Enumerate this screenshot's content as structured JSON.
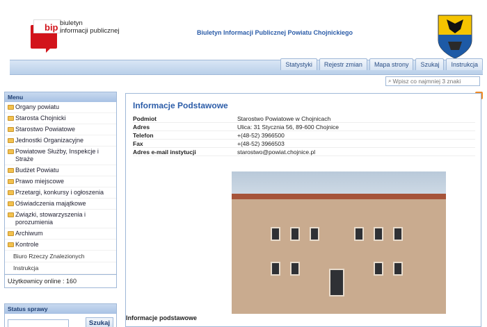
{
  "header": {
    "logo_bip": "bip",
    "logo_line1": "biuletyn",
    "logo_line2": "informacji publicznej",
    "site_title": "Biuletyn Informacji Publicznej Powiatu Chojnickiego"
  },
  "nav": {
    "tabs": [
      "Statystyki",
      "Rejestr zmian",
      "Mapa strony",
      "Szukaj",
      "Instrukcja"
    ],
    "search_placeholder": "Wpisz co najmniej 3 znaki"
  },
  "sidebar": {
    "menu_title": "Menu",
    "items": [
      "Organy powiatu",
      "Starosta Chojnicki",
      "Starostwo Powiatowe",
      "Jednostki Organizacyjne",
      "Powiatowe Służby, Inspekcje i Straże",
      "Budżet Powiatu",
      "Prawo miejscowe",
      "Przetargi, konkursy i ogłoszenia",
      "Oświadczenia majątkowe",
      "Związki, stowarzyszenia i porozumienia",
      "Archiwum",
      "Kontrole"
    ],
    "sub_items": [
      "Biuro Rzeczy Znalezionych",
      "Instrukcja"
    ],
    "online_label": "Użytkownicy online : 160",
    "status_title": "Status sprawy",
    "status_button": "Szukaj"
  },
  "main": {
    "title": "Informacje Podstawowe",
    "rows": [
      {
        "label": "Podmiot",
        "value": "Starostwo Powiatowe w Chojnicach"
      },
      {
        "label": "Adres",
        "value": "Ulica: 31 Stycznia 56, 89-600 Chojnice"
      },
      {
        "label": "Telefon",
        "value": "+(48-52) 3966500"
      },
      {
        "label": "Fax",
        "value": "+(48-52) 3966503"
      },
      {
        "label": "Adres e-mail instytucji",
        "value": "starostwo@powiat.chojnice.pl"
      }
    ],
    "footer_title": "Informacje podstawowe"
  },
  "tools": [
    "print-icon",
    "mail-icon",
    "accessibility-icon",
    "contrast-icon",
    "font-increase-icon",
    "font-decrease-icon",
    "rss-icon"
  ],
  "colors": {
    "accent": "#2b5ca8",
    "logo_red": "#d2141b",
    "border": "#9fb8d8"
  }
}
